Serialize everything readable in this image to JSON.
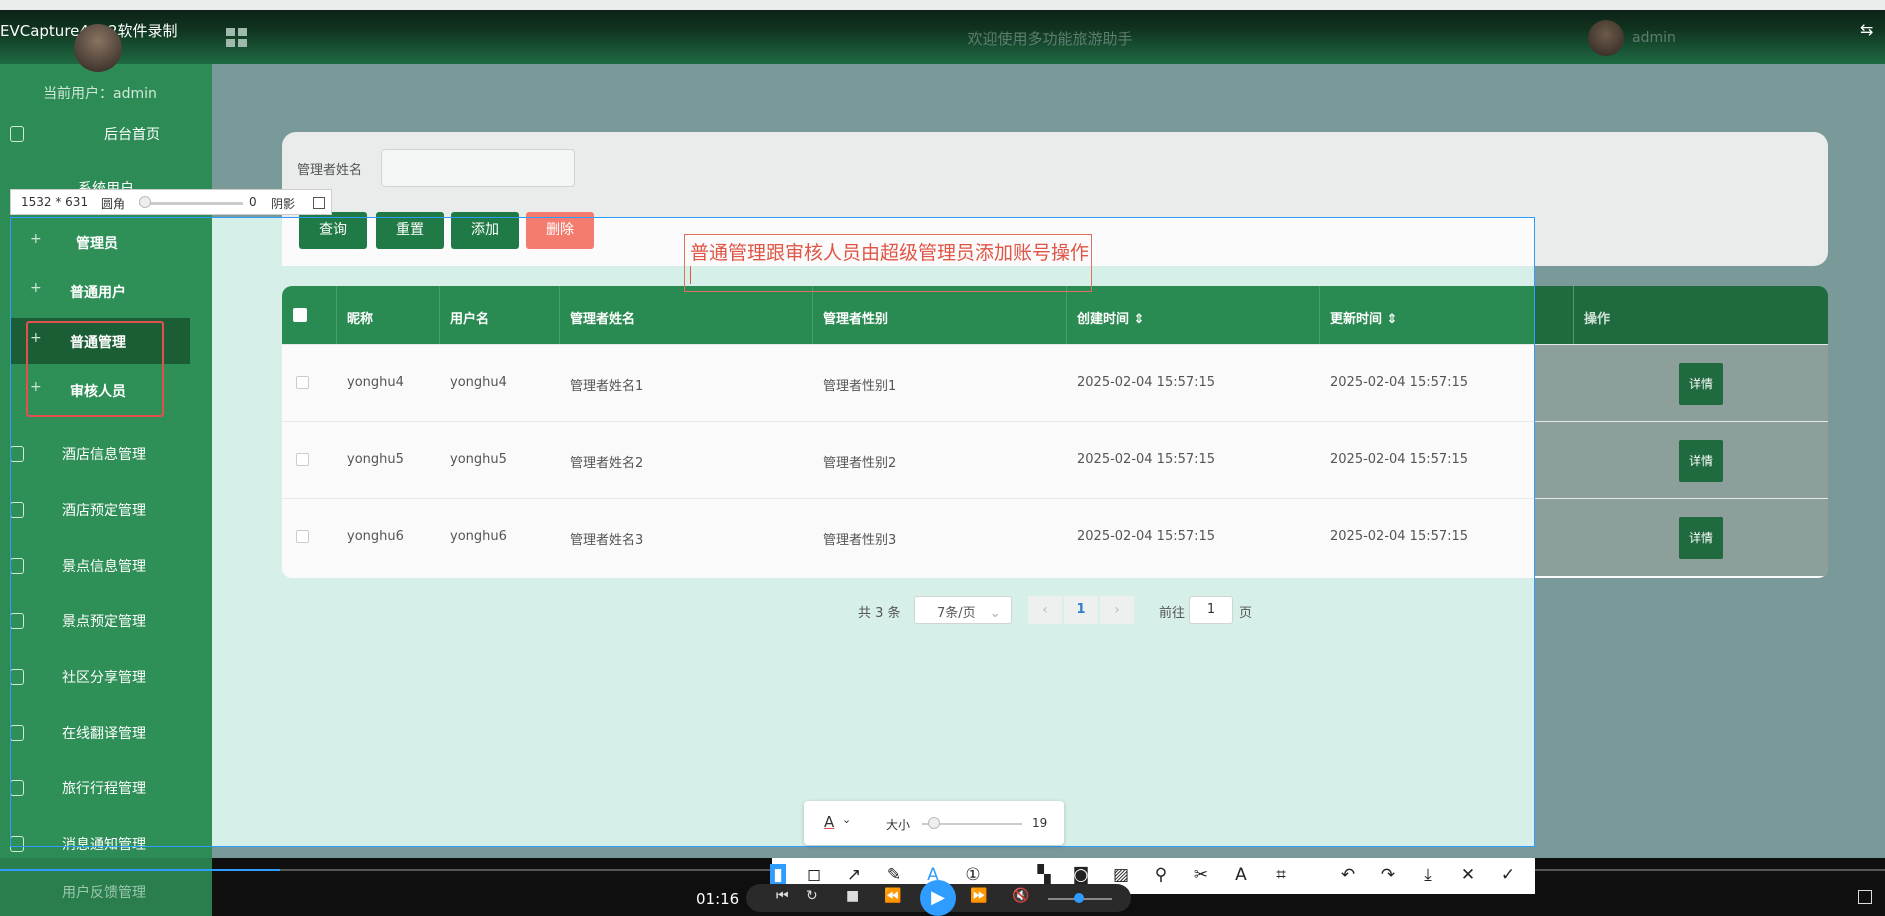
{
  "recorder": {
    "title": "EVCapture4.2.2软件录制",
    "time": "01:16"
  },
  "header": {
    "welcome": "欢迎使用多功能旅游助手",
    "user": "admin"
  },
  "sidebar": {
    "current_user": "当前用户：admin",
    "top_items": [
      {
        "label": "后台首页",
        "icon": "home-icon"
      },
      {
        "label": "系统用户",
        "icon": "user-icon"
      }
    ],
    "sub_items": [
      "管理员",
      "普通用户",
      "普通管理",
      "审核人员"
    ],
    "items": [
      {
        "label": "酒店信息管理",
        "icon": "chat-icon"
      },
      {
        "label": "酒店预定管理",
        "icon": "doc-icon"
      },
      {
        "label": "景点信息管理",
        "icon": "shield-icon"
      },
      {
        "label": "景点预定管理",
        "icon": "columns-icon"
      },
      {
        "label": "社区分享管理",
        "icon": "doc-icon"
      },
      {
        "label": "在线翻译管理",
        "icon": "chat-icon"
      },
      {
        "label": "旅行行程管理",
        "icon": "shield-icon"
      },
      {
        "label": "消息通知管理",
        "icon": "doc-icon"
      },
      {
        "label": "用户反馈管理",
        "icon": "shield-icon"
      }
    ]
  },
  "capture": {
    "size": "1532 * 631",
    "radius_label": "圆角",
    "radius_value": "0",
    "shadow_label": "阴影"
  },
  "search": {
    "label": "管理者姓名",
    "value": ""
  },
  "buttons": {
    "query": "查询",
    "reset": "重置",
    "add": "添加",
    "delete": "删除"
  },
  "annotation": "普通管理跟审核人员由超级管理员添加账号操作",
  "table": {
    "headers": [
      "昵称",
      "用户名",
      "管理者姓名",
      "管理者性别",
      "创建时间",
      "更新时间",
      "操作"
    ],
    "rows": [
      {
        "nickname": "yonghu4",
        "username": "yonghu4",
        "name": "管理者姓名1",
        "gender": "管理者性别1",
        "created": "2025-02-04 15:57:15",
        "updated": "2025-02-04 15:57:15",
        "action": "详情"
      },
      {
        "nickname": "yonghu5",
        "username": "yonghu5",
        "name": "管理者姓名2",
        "gender": "管理者性别2",
        "created": "2025-02-04 15:57:15",
        "updated": "2025-02-04 15:57:15",
        "action": "详情"
      },
      {
        "nickname": "yonghu6",
        "username": "yonghu6",
        "name": "管理者姓名3",
        "gender": "管理者性别3",
        "created": "2025-02-04 15:57:15",
        "updated": "2025-02-04 15:57:15",
        "action": "详情"
      }
    ]
  },
  "pagination": {
    "total": "共 3 条",
    "page_size": "7条/页",
    "current": "1",
    "goto_label": "前往",
    "goto_value": "1",
    "page_suffix": "页"
  },
  "text_toolbar": {
    "font_icon": "A",
    "size_label": "大小",
    "size_value": "19"
  },
  "colors": {
    "primary": "#2a8b52",
    "dark": "#1f6a3f",
    "danger": "#f47c6e",
    "accent": "#2f9cff",
    "annotation": "#e05545"
  }
}
